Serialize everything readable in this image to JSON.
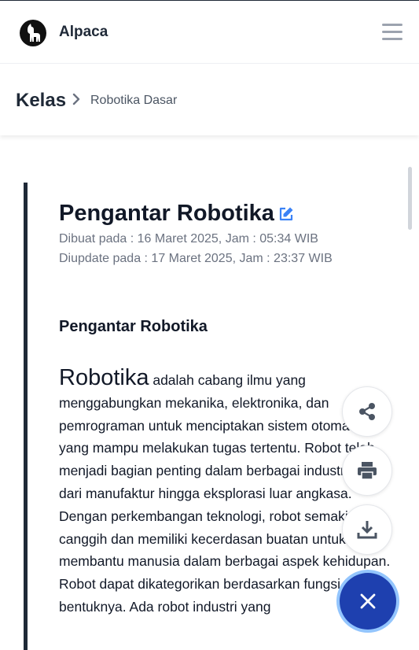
{
  "app": {
    "name": "Alpaca"
  },
  "icons": {
    "logo": "alpaca-logo-icon",
    "menu": "hamburger-menu-icon",
    "edit": "edit-icon",
    "share": "share-icon",
    "print": "print-icon",
    "download": "download-icon",
    "close": "close-icon"
  },
  "breadcrumb": {
    "root": "Kelas",
    "current": "Robotika Dasar"
  },
  "article": {
    "title": "Pengantar Robotika",
    "created": "Dibuat pada : 16 Maret 2025, Jam : 05:34 WIB",
    "updated": "Diupdate pada : 17 Maret 2025, Jam : 23:37 WIB",
    "heading": "Pengantar Robotika",
    "lead_word": "Robotika",
    "paragraph1": " adalah cabang ilmu yang menggabungkan mekanika, elektronika, dan pemrograman untuk menciptakan sistem otomatis yang mampu melakukan tugas tertentu. Robot telah menjadi bagian penting dalam berbagai industri, mulai dari manufaktur hingga eksplorasi luar angkasa. Dengan perkembangan teknologi, robot semakin canggih dan memiliki kecerdasan buatan untuk membantu manusia dalam berbagai aspek kehidupan.",
    "paragraph2": "Robot dapat dikategorikan berdasarkan fungsi dan bentuknya. Ada robot industri yang"
  },
  "colors": {
    "accent": "#1e40af",
    "sidebar_bar": "#1f2937",
    "muted_text": "#6b7280"
  }
}
